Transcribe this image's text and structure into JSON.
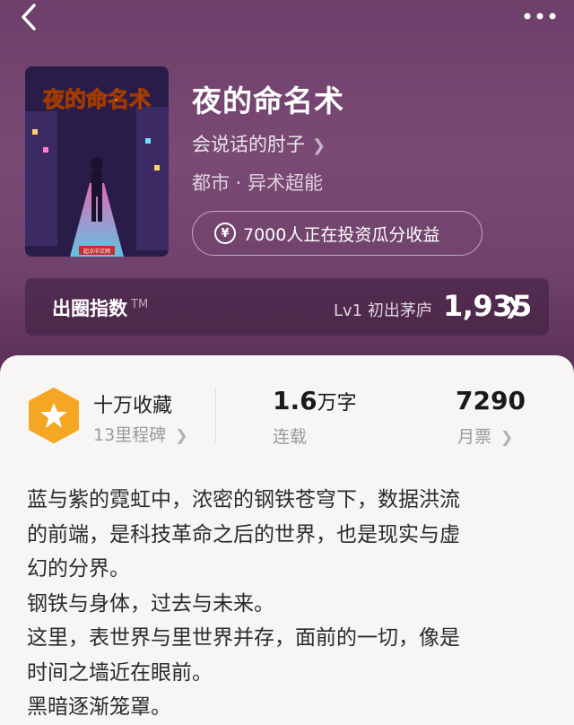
{
  "book": {
    "title": "夜的命名术",
    "author": "会说话的肘子",
    "genre": "都市 · 异术超能",
    "invest_text": "7000人正在投资瓜分收益",
    "cover_title_art": "夜的命名术",
    "cover_publisher": "起点中文网"
  },
  "index_bar": {
    "label": "出圈指数",
    "tm": "TM",
    "level_text": "Lv1 初出茅庐",
    "score": "1,935"
  },
  "stats": {
    "collect_title": "十万收藏",
    "collect_sub": "13里程碑",
    "words_value": "1.6",
    "words_unit": "万字",
    "words_sub": "连载",
    "votes_value": "7290",
    "votes_sub": "月票"
  },
  "description": [
    "蓝与紫的霓虹中，浓密的钢铁苍穹下，数据洪流",
    "的前端，是科技革命之后的世界，也是现实与虚",
    "幻的分界。",
    "钢铁与身体，过去与未来。",
    "这里，表世界与里世界并存，面前的一切，像是",
    "时间之墙近在眼前。",
    "黑暗逐渐笼罩。"
  ],
  "icons": {
    "back": "chevron-left-icon",
    "more": "more-dots-icon",
    "yen": "yen-coin-icon",
    "star_badge": "star-badge-icon"
  },
  "colors": {
    "header_bg": "#6e3f6a",
    "panel_bg": "#f8f6f4",
    "badge_orange": "#f5a623"
  }
}
